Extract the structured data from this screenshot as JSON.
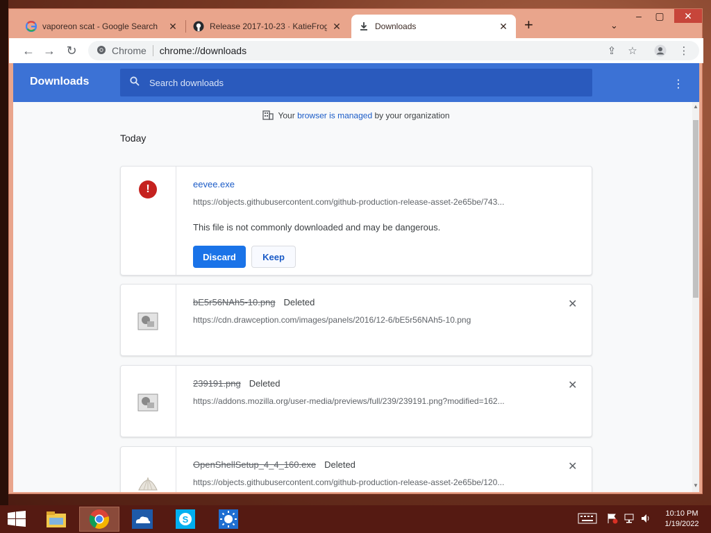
{
  "browser": {
    "tabs": [
      {
        "label": "vaporeon scat - Google Search",
        "icon": "google-g-icon"
      },
      {
        "label": "Release 2017-10-23 · KatieFrogs/...",
        "icon": "github-icon"
      },
      {
        "label": "Downloads",
        "icon": "download-icon"
      }
    ],
    "omnibox": {
      "site": "Chrome",
      "url": "chrome://downloads"
    }
  },
  "downloads": {
    "title": "Downloads",
    "search_placeholder": "Search downloads",
    "managed": {
      "prefix": "Your ",
      "link": "browser is managed",
      "suffix": " by your organization"
    },
    "day": "Today",
    "items": [
      {
        "name": "eevee.exe",
        "url": "https://objects.githubusercontent.com/github-production-release-asset-2e65be/743...",
        "warning": "This file is not commonly downloaded and may be dangerous.",
        "discard": "Discard",
        "keep": "Keep"
      },
      {
        "name": "bE5r56NAh5-10.png",
        "status": "Deleted",
        "url": "https://cdn.drawception.com/images/panels/2016/12-6/bE5r56NAh5-10.png"
      },
      {
        "name": "239191.png",
        "status": "Deleted",
        "url": "https://addons.mozilla.org/user-media/previews/full/239/239191.png?modified=162..."
      },
      {
        "name": "OpenShellSetup_4_4_160.exe",
        "status": "Deleted",
        "url": "https://objects.githubusercontent.com/github-production-release-asset-2e65be/120..."
      }
    ]
  },
  "taskbar": {
    "time": "10:10 PM",
    "date": "1/19/2022"
  },
  "colors": {
    "header": "#3c72d5",
    "accent": "#1a73e8",
    "danger": "#c5221f"
  }
}
